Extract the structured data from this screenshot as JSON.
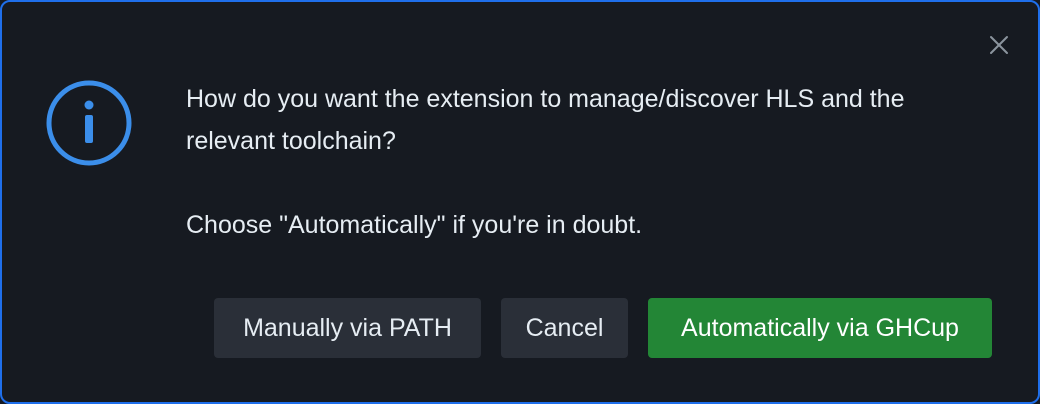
{
  "dialog": {
    "message_line1": "How do you want the extension to manage/discover HLS and the relevant toolchain?",
    "message_line2": "Choose \"Automatically\" if you're in doubt.",
    "icons": {
      "status": "info-icon",
      "close": "close-icon"
    },
    "buttons": {
      "manual_label": "Manually via PATH",
      "cancel_label": "Cancel",
      "auto_label": "Automatically via GHCup"
    },
    "colors": {
      "background": "#161a21",
      "border": "#1f6feb",
      "info_icon": "#3b8eea",
      "primary_button": "#238636",
      "secondary_button": "#2a2f38",
      "text": "#e6edf3"
    }
  }
}
